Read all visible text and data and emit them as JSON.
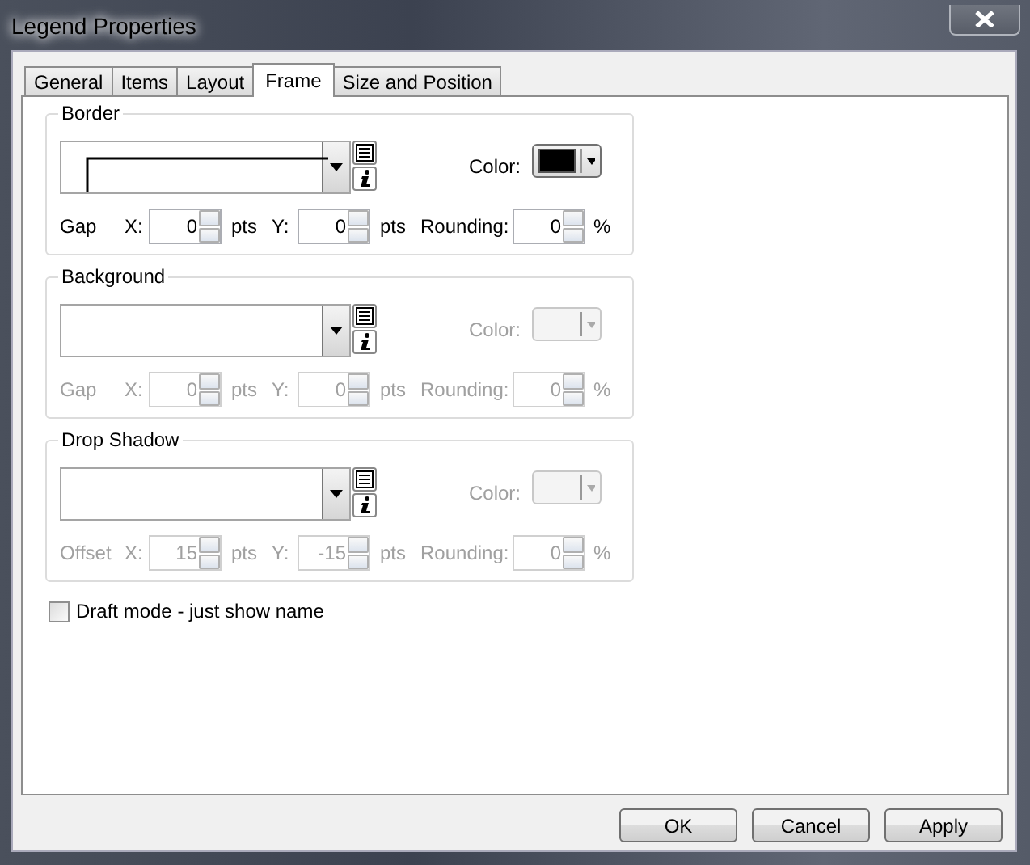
{
  "window": {
    "title": "Legend Properties"
  },
  "tabs": [
    {
      "label": "General",
      "selected": false
    },
    {
      "label": "Items",
      "selected": false
    },
    {
      "label": "Layout",
      "selected": false
    },
    {
      "label": "Frame",
      "selected": true
    },
    {
      "label": "Size and Position",
      "selected": false
    }
  ],
  "sections": [
    {
      "title": "Border",
      "enabled": true,
      "line_sample": true,
      "color_label": "Color:",
      "color": "#000000",
      "row_label": "Gap",
      "x_label": "X:",
      "x_value": "0",
      "x_unit": "pts",
      "y_label": "Y:",
      "y_value": "0",
      "y_unit": "pts",
      "rounding_label": "Rounding:",
      "rounding_value": "0",
      "rounding_unit": "%"
    },
    {
      "title": "Background",
      "enabled": false,
      "line_sample": false,
      "color_label": "Color:",
      "row_label": "Gap",
      "x_label": "X:",
      "x_value": "0",
      "x_unit": "pts",
      "y_label": "Y:",
      "y_value": "0",
      "y_unit": "pts",
      "rounding_label": "Rounding:",
      "rounding_value": "0",
      "rounding_unit": "%"
    },
    {
      "title": "Drop Shadow",
      "enabled": false,
      "line_sample": false,
      "color_label": "Color:",
      "row_label": "Offset",
      "x_label": "X:",
      "x_value": "15",
      "x_unit": "pts",
      "y_label": "Y:",
      "y_value": "-15",
      "y_unit": "pts",
      "rounding_label": "Rounding:",
      "rounding_value": "0",
      "rounding_unit": "%"
    }
  ],
  "draft_mode": {
    "label": "Draft mode - just show name",
    "checked": false
  },
  "buttons": [
    "OK",
    "Cancel",
    "Apply"
  ]
}
